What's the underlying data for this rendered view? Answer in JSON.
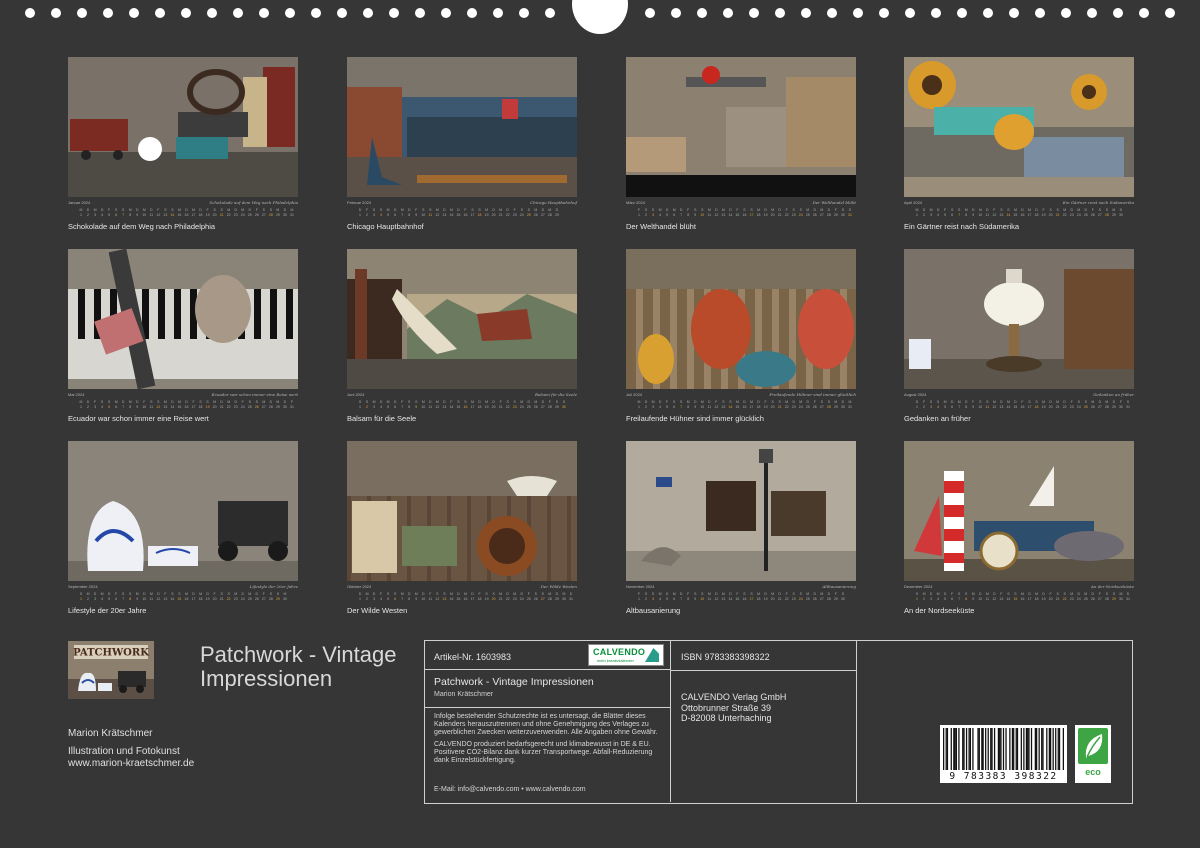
{
  "months": [
    {
      "key": "jan",
      "label": "Januar 2024",
      "credit": "Schokolade auf dem Weg nach Philadelphia",
      "caption": "Schokolade auf dem Weg nach Philadelphia",
      "scene": [
        "Santa Fe",
        "all the way",
        "Bitte",
        "Tür",
        "schließen"
      ]
    },
    {
      "key": "feb",
      "label": "Februar 2024",
      "credit": "Chicago Hauptbahnhof",
      "caption": "Chicago Hauptbahnhof",
      "scene": []
    },
    {
      "key": "mar",
      "label": "März 2024",
      "credit": "Der Welthandel blüht",
      "caption": "Der Welthandel blüht",
      "scene": []
    },
    {
      "key": "apr",
      "label": "April 2024",
      "credit": "Ein Gärtner reist nach Südamerika",
      "caption": "Ein Gärtner reist nach Südamerika",
      "scene": []
    },
    {
      "key": "may",
      "label": "Mai 2024",
      "credit": "Ecuador war schon immer eine Reise wert",
      "caption": "Ecuador war schon immer eine Reise wert",
      "scene": []
    },
    {
      "key": "jun",
      "label": "Juni 2024",
      "credit": "Balsam für die Seele",
      "caption": "Balsam für die Seele",
      "scene": []
    },
    {
      "key": "jul",
      "label": "Juli 2024",
      "credit": "Freilaufende Hühner sind immer glücklich",
      "caption": "Freilaufende Hühner sind immer glücklich",
      "scene": []
    },
    {
      "key": "aug",
      "label": "August 2024",
      "credit": "Gedanken an früher",
      "caption": "Gedanken an früher",
      "scene": []
    },
    {
      "key": "sep",
      "label": "September 2024",
      "credit": "Lifestyle der 20er Jahre",
      "caption": "Lifestyle der 20er Jahre",
      "scene": []
    },
    {
      "key": "oct",
      "label": "Oktober 2024",
      "credit": "Der Wilde Westen",
      "caption": "Der Wilde Westen",
      "scene": []
    },
    {
      "key": "nov",
      "label": "November 2024",
      "credit": "Altbausanierung",
      "caption": "Altbausanierung",
      "scene": []
    },
    {
      "key": "dec",
      "label": "Dezember 2024",
      "credit": "An der Nordseeküste",
      "caption": "An der Nordseeküste",
      "scene": []
    }
  ],
  "cover": {
    "thumb_word": "PATCHWORK",
    "title": "Patchwork - Vintage Impressionen",
    "author": "Marion Krätschmer",
    "tagline": "Illustration und Fotokunst",
    "website": "www.marion-kraetschmer.de"
  },
  "panel": {
    "article_number": "Artikel-Nr. 1603983",
    "logo_text": "CALVENDO",
    "logo_sub": "mein kreativkalender",
    "product_title": "Patchwork - Vintage Impressionen",
    "product_author": "Marion Krätschmer",
    "legal_1": "Infolge bestehender Schutzrechte ist es untersagt, die Blätter dieses Kalenders herauszutrennen und ohne Genehmigung des Verlages zu gewerblichen Zwecken weiterzuverwenden. Alle Angaben ohne Gewähr.",
    "legal_2": "CALVENDO produziert bedarfsgerecht und klimabewusst in DE & EU. Positivere CO2-Bilanz dank kurzer Transportwege. Abfall-Reduzierung dank Einzelstückfertigung.",
    "contact": "E-Mail: info@calvendo.com • www.calvendo.com",
    "isbn": "ISBN 9783383398322",
    "publisher_name": "CALVENDO Verlag GmbH",
    "publisher_street": "Ottobrunner Straße 39",
    "publisher_city": "D-82008 Unterhaching",
    "barcode_number": "9 783383 398322",
    "eco_label": "eco"
  },
  "colors": {
    "background": "#363636",
    "panel_border": "#d0d0d0",
    "logo_green": "#0a8f3c",
    "eco_green": "#3da544",
    "sunday": "#e0a040"
  }
}
